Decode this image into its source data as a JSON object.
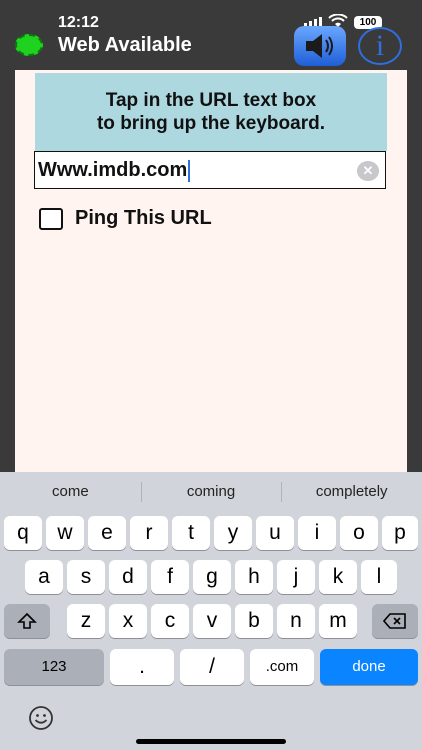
{
  "status": {
    "time": "12:12",
    "battery": "100",
    "web_status": "Web Available"
  },
  "instructions": {
    "line1": "Tap in the URL text box",
    "line2": "to bring up the keyboard."
  },
  "url_field": {
    "value": "Www.imdb.com"
  },
  "ping": {
    "label": "Ping This URL",
    "checked": false
  },
  "suggestions": [
    "come",
    "coming",
    "completely"
  ],
  "keyboard": {
    "row1": [
      "q",
      "w",
      "e",
      "r",
      "t",
      "y",
      "u",
      "i",
      "o",
      "p"
    ],
    "row2": [
      "a",
      "s",
      "d",
      "f",
      "g",
      "h",
      "j",
      "k",
      "l"
    ],
    "row3": [
      "z",
      "x",
      "c",
      "v",
      "b",
      "n",
      "m"
    ],
    "bottom": {
      "numbers": "123",
      "dot": ".",
      "slash": "/",
      "dotcom": ".com",
      "done": "done"
    }
  },
  "colors": {
    "accent": "#0a84ff",
    "status_green": "#1fd21f",
    "instruction_bg": "#add8e0",
    "content_bg": "#fff4ef"
  }
}
